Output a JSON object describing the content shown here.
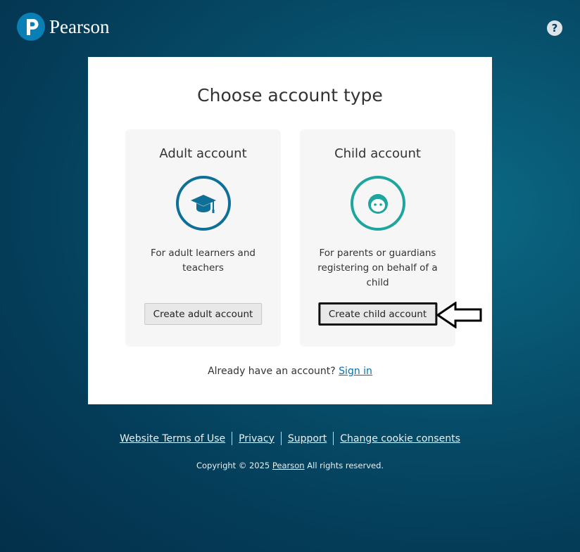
{
  "brand": {
    "name": "Pearson"
  },
  "header": {
    "help_label": "?"
  },
  "card": {
    "title": "Choose account type",
    "adult": {
      "title": "Adult account",
      "icon": "graduation-cap-icon",
      "description": "For adult learners and teachers",
      "button": "Create adult account"
    },
    "child": {
      "title": "Child account",
      "icon": "child-face-icon",
      "description": "For parents or guardians registering on behalf of a child",
      "button": "Create child account"
    },
    "signin_prompt": "Already have an account?",
    "signin_link": "Sign in"
  },
  "footer": {
    "links": [
      "Website Terms of Use",
      "Privacy",
      "Support",
      "Change cookie consents"
    ],
    "copyright_prefix": "Copyright © 2025",
    "copyright_link": "Pearson",
    "copyright_suffix": "All rights reserved."
  },
  "colors": {
    "background": "#05486a",
    "adult_icon": "#0e6f97",
    "child_icon": "#1ea59d",
    "link": "#0a6ea8"
  }
}
